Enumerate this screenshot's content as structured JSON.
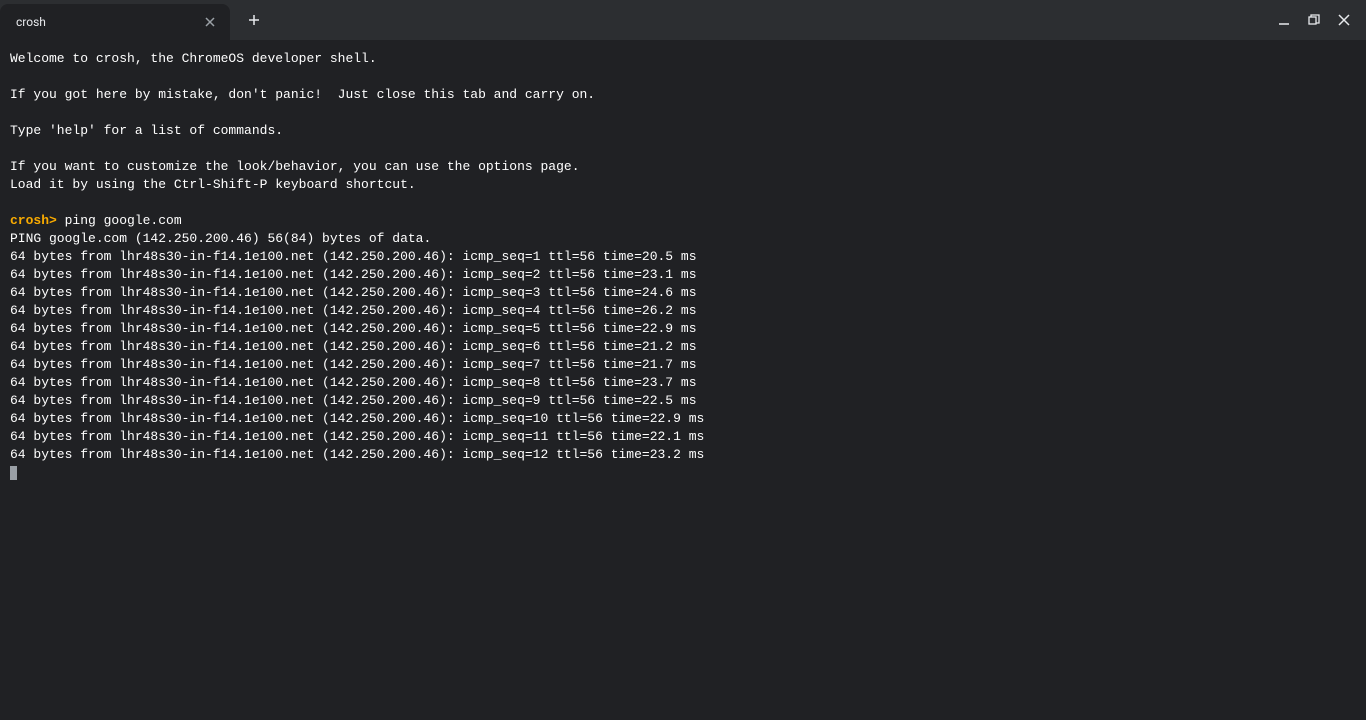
{
  "tab": {
    "title": "crosh"
  },
  "terminal": {
    "welcome_line": "Welcome to crosh, the ChromeOS developer shell.",
    "mistake_line": "If you got here by mistake, don't panic!  Just close this tab and carry on.",
    "help_line": "Type 'help' for a list of commands.",
    "customize_line1": "If you want to customize the look/behavior, you can use the options page.",
    "customize_line2": "Load it by using the Ctrl-Shift-P keyboard shortcut.",
    "prompt": "crosh>",
    "command": " ping google.com",
    "ping_header": "PING google.com (142.250.200.46) 56(84) bytes of data.",
    "ping_lines": [
      "64 bytes from lhr48s30-in-f14.1e100.net (142.250.200.46): icmp_seq=1 ttl=56 time=20.5 ms",
      "64 bytes from lhr48s30-in-f14.1e100.net (142.250.200.46): icmp_seq=2 ttl=56 time=23.1 ms",
      "64 bytes from lhr48s30-in-f14.1e100.net (142.250.200.46): icmp_seq=3 ttl=56 time=24.6 ms",
      "64 bytes from lhr48s30-in-f14.1e100.net (142.250.200.46): icmp_seq=4 ttl=56 time=26.2 ms",
      "64 bytes from lhr48s30-in-f14.1e100.net (142.250.200.46): icmp_seq=5 ttl=56 time=22.9 ms",
      "64 bytes from lhr48s30-in-f14.1e100.net (142.250.200.46): icmp_seq=6 ttl=56 time=21.2 ms",
      "64 bytes from lhr48s30-in-f14.1e100.net (142.250.200.46): icmp_seq=7 ttl=56 time=21.7 ms",
      "64 bytes from lhr48s30-in-f14.1e100.net (142.250.200.46): icmp_seq=8 ttl=56 time=23.7 ms",
      "64 bytes from lhr48s30-in-f14.1e100.net (142.250.200.46): icmp_seq=9 ttl=56 time=22.5 ms",
      "64 bytes from lhr48s30-in-f14.1e100.net (142.250.200.46): icmp_seq=10 ttl=56 time=22.9 ms",
      "64 bytes from lhr48s30-in-f14.1e100.net (142.250.200.46): icmp_seq=11 ttl=56 time=22.1 ms",
      "64 bytes from lhr48s30-in-f14.1e100.net (142.250.200.46): icmp_seq=12 ttl=56 time=23.2 ms"
    ]
  }
}
